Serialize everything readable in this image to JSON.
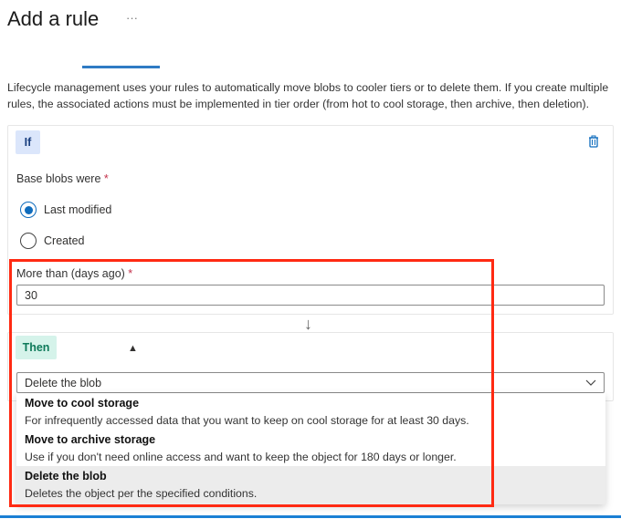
{
  "header": {
    "title": "Add a rule",
    "more_label": "···"
  },
  "description": "Lifecycle management uses your rules to automatically move blobs to cooler tiers or to delete them. If you create multiple rules, the associated actions must be implemented in tier order (from hot to cool storage, then archive, then deletion).",
  "if_block": {
    "badge": "If",
    "base_blobs_label": "Base blobs were",
    "required_mark": "*",
    "radios": [
      {
        "label": "Last modified",
        "checked": true
      },
      {
        "label": "Created",
        "checked": false
      }
    ],
    "days_label": "More than (days ago)",
    "days_value": "30"
  },
  "then_block": {
    "badge": "Then",
    "selected": "Delete the blob",
    "options": [
      {
        "title": "Move to cool storage",
        "desc": "For infrequently accessed data that you want to keep on cool storage for at least 30 days."
      },
      {
        "title": "Move to archive storage",
        "desc": "Use if you don't need online access and want to keep the object for 180 days or longer."
      },
      {
        "title": "Delete the blob",
        "desc": "Deletes the object per the specified conditions.",
        "selected": true
      }
    ]
  },
  "colors": {
    "accent": "#0f6cbd",
    "highlight_box": "#ff2a12",
    "if_badge_bg": "#dbe6fb",
    "then_badge_bg": "#d5f3ea"
  }
}
